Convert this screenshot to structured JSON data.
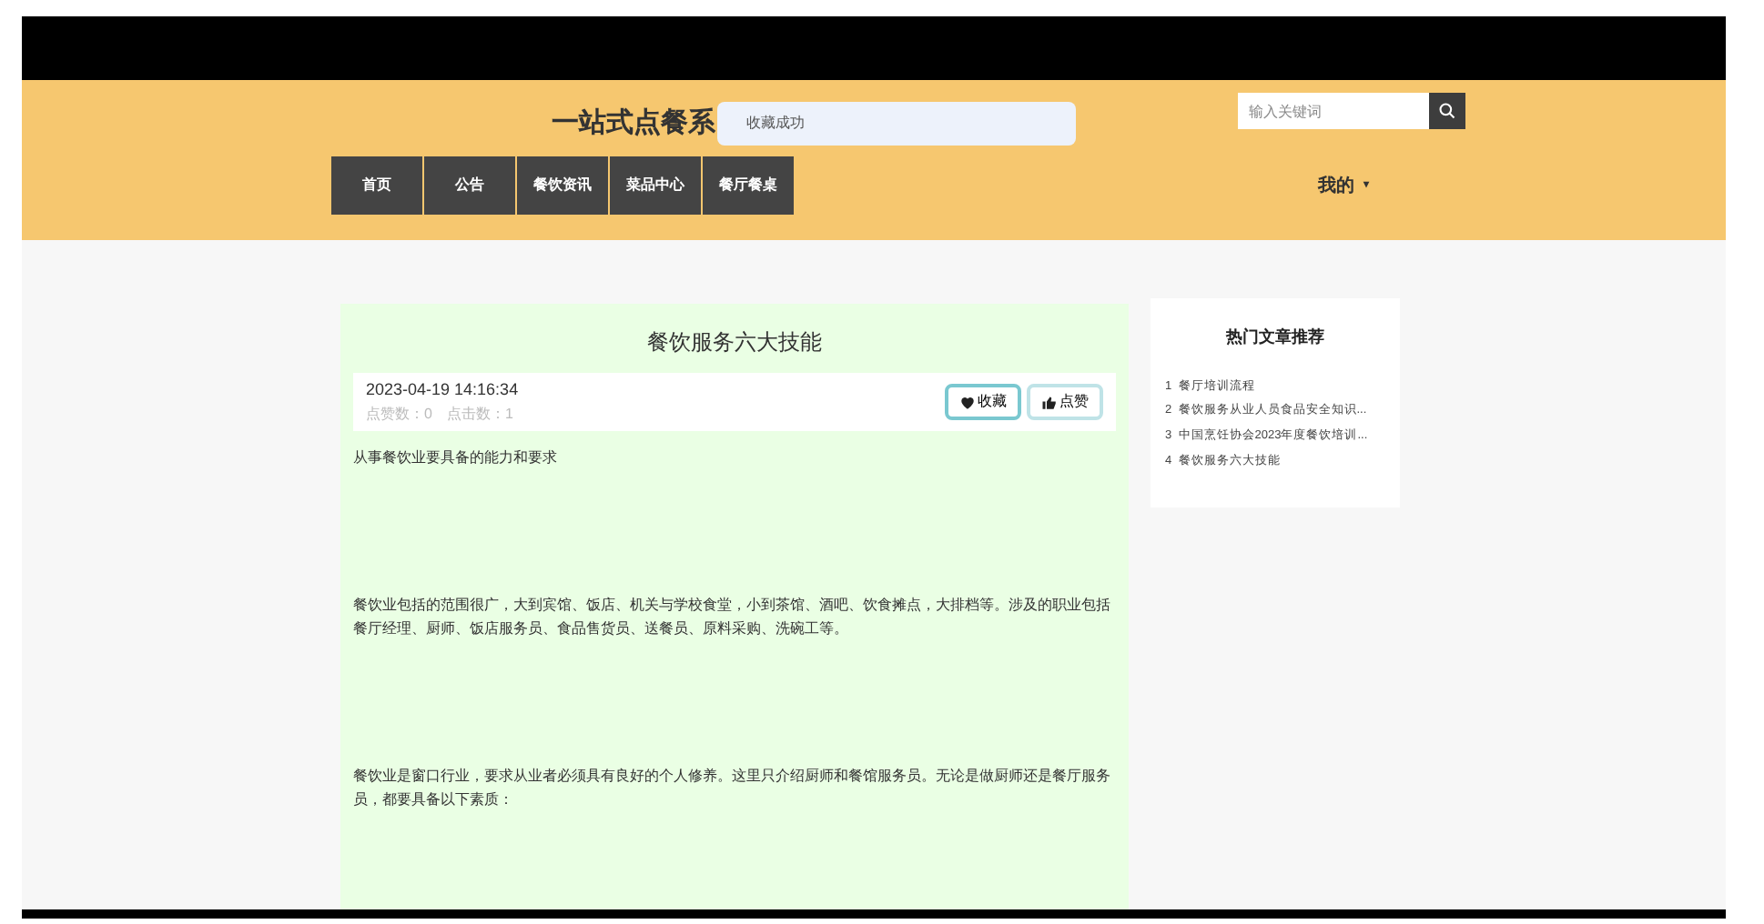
{
  "header": {
    "site_title": "一站式点餐系",
    "toast": "收藏成功",
    "search": {
      "placeholder": "输入关键词"
    },
    "nav": [
      {
        "label": "首页",
        "selected": false
      },
      {
        "label": "公告",
        "selected": false
      },
      {
        "label": "餐饮资讯",
        "selected": false
      },
      {
        "label": "菜品中心",
        "selected": false
      },
      {
        "label": "餐厅餐桌",
        "selected": false
      }
    ],
    "user_menu": {
      "label": "我的",
      "caret": "▾"
    }
  },
  "article": {
    "title": "餐饮服务六大技能",
    "date": "2023-04-19 14:16:34",
    "stats": "点赞数：0　点击数：1",
    "buttons": [
      {
        "kind": "favorite",
        "label": "收藏"
      },
      {
        "kind": "like",
        "label": "点赞"
      }
    ],
    "paragraphs": [
      "从事餐饮业要具备的能力和要求",
      "餐饮业包括的范围很广，大到宾馆、饭店、机关与学校食堂，小到茶馆、酒吧、饮食摊点，大排档等。涉及的职业包括餐厅经理、厨师、饭店服务员、食品售货员、送餐员、原料采购、洗碗工等。",
      "餐饮业是窗口行业，要求从业者必须具有良好的个人修养。这里只介绍厨师和餐馆服务员。无论是做厨师还是餐厅服务员，都要具备以下素质："
    ]
  },
  "sidebar": {
    "title": "热门文章推荐",
    "items": [
      {
        "index": "1",
        "title": "餐厅培训流程"
      },
      {
        "index": "2",
        "title": "餐饮服务从业人员食品安全知识..."
      },
      {
        "index": "3",
        "title": "中国烹饪协会2023年度餐饮培训..."
      },
      {
        "index": "4",
        "title": "餐饮服务六大技能"
      }
    ]
  }
}
